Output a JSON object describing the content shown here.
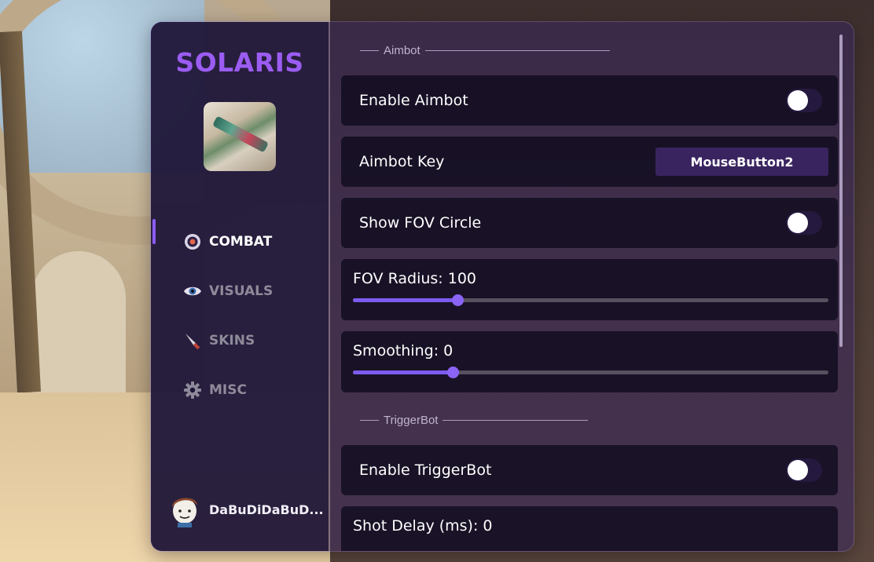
{
  "app": {
    "logo": "SOLARIS"
  },
  "sidebar": {
    "items": [
      {
        "label": "COMBAT",
        "icon": "target-icon",
        "active": true
      },
      {
        "label": "VISUALS",
        "icon": "eye-icon",
        "active": false
      },
      {
        "label": "SKINS",
        "icon": "knife-icon",
        "active": false
      },
      {
        "label": "MISC",
        "icon": "gear-icon",
        "active": false
      }
    ],
    "user": {
      "name": "DaBuDiDaBuD..."
    }
  },
  "aimbot": {
    "title": "Aimbot",
    "enable_label": "Enable Aimbot",
    "enable_value": false,
    "key_label": "Aimbot Key",
    "key_value": "MouseButton2",
    "fov_circle_label": "Show FOV Circle",
    "fov_circle_value": false,
    "fov_radius_label": "FOV Radius: 100",
    "fov_radius_fraction": 0.22,
    "smoothing_label": "Smoothing: 0",
    "smoothing_fraction": 0.21
  },
  "triggerbot": {
    "title": "TriggerBot",
    "enable_label": "Enable TriggerBot",
    "enable_value": false,
    "shot_delay_label": "Shot Delay (ms): 0"
  },
  "colors": {
    "accent": "#8b5cf6",
    "logo": "#9b5cf2",
    "keybind_bg": "#3a2460"
  }
}
